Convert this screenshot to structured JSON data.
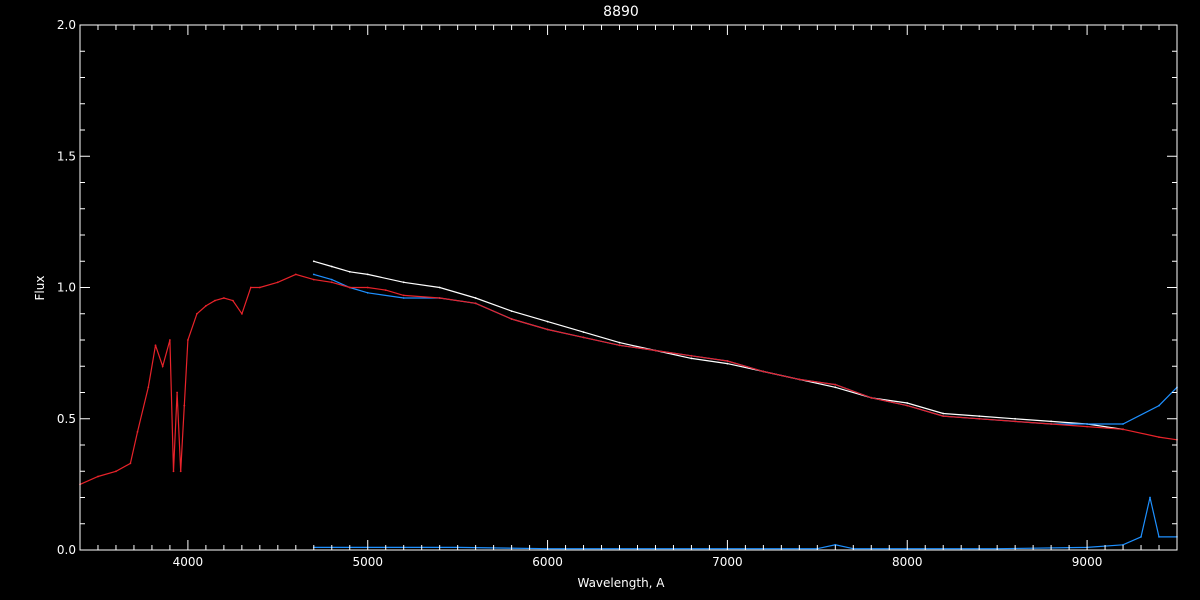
{
  "chart_data": {
    "type": "line",
    "title": "8890",
    "xlabel": "Wavelength, A",
    "ylabel": "Flux",
    "xlim": [
      3400,
      9500
    ],
    "ylim": [
      0.0,
      2.0
    ],
    "xticks": [
      4000,
      5000,
      6000,
      7000,
      8000,
      9000
    ],
    "xtick_labels": [
      "4000",
      "5000",
      "6000",
      "7000",
      "8000",
      "9000"
    ],
    "yticks": [
      0.0,
      0.5,
      1.0,
      1.5,
      2.0
    ],
    "ytick_labels": [
      "0.0",
      "0.5",
      "1.0",
      "1.5",
      "2.0"
    ],
    "grid": false,
    "background": "#000000",
    "series": [
      {
        "color": "#ffffff",
        "x": [
          4700,
          4800,
          4900,
          5000,
          5200,
          5400,
          5600,
          5800,
          6000,
          6200,
          6400,
          6600,
          6800,
          7000,
          7200,
          7400,
          7600,
          7800,
          8000,
          8200,
          8400,
          8600,
          8800,
          9000,
          9200
        ],
        "values": [
          1.1,
          1.08,
          1.06,
          1.05,
          1.02,
          1.0,
          0.96,
          0.91,
          0.87,
          0.83,
          0.79,
          0.76,
          0.73,
          0.71,
          0.68,
          0.65,
          0.62,
          0.58,
          0.56,
          0.52,
          0.51,
          0.5,
          0.49,
          0.48,
          0.46
        ]
      },
      {
        "color": "#1e90ff",
        "x": [
          4700,
          4800,
          4900,
          5000,
          5200,
          5400,
          5600,
          5800,
          6000,
          6200,
          6400,
          6600,
          6800,
          7000,
          7200,
          7400,
          7600,
          7800,
          8000,
          8200,
          8400,
          8600,
          8800,
          9000,
          9200,
          9400,
          9500
        ],
        "values": [
          1.05,
          1.03,
          1.0,
          0.98,
          0.96,
          0.96,
          0.94,
          0.88,
          0.84,
          0.81,
          0.78,
          0.76,
          0.74,
          0.72,
          0.68,
          0.65,
          0.63,
          0.58,
          0.55,
          0.51,
          0.5,
          0.49,
          0.48,
          0.48,
          0.48,
          0.55,
          0.62
        ]
      },
      {
        "color": "#1e90ff",
        "x": [
          4700,
          5000,
          5500,
          6000,
          6500,
          7000,
          7500,
          7600,
          7700,
          8000,
          8500,
          9000,
          9200,
          9300,
          9350,
          9400,
          9500
        ],
        "values": [
          0.01,
          0.01,
          0.01,
          0.005,
          0.005,
          0.005,
          0.005,
          0.02,
          0.005,
          0.005,
          0.005,
          0.01,
          0.02,
          0.05,
          0.2,
          0.05,
          0.05
        ]
      },
      {
        "color": "#e8232a",
        "x": [
          3400,
          3500,
          3600,
          3680,
          3720,
          3780,
          3820,
          3860,
          3900,
          3920,
          3940,
          3960,
          3980,
          4000,
          4050,
          4100,
          4150,
          4200,
          4250,
          4300,
          4350,
          4400,
          4500,
          4600,
          4700,
          4800,
          4900,
          5000,
          5100,
          5200,
          5400,
          5600,
          5800,
          6000,
          6200,
          6400,
          6600,
          6800,
          7000,
          7200,
          7400,
          7600,
          7800,
          8000,
          8200,
          8400,
          8600,
          8800,
          9000,
          9200,
          9400,
          9500
        ],
        "values": [
          0.25,
          0.28,
          0.3,
          0.33,
          0.45,
          0.62,
          0.78,
          0.7,
          0.8,
          0.3,
          0.6,
          0.3,
          0.55,
          0.8,
          0.9,
          0.93,
          0.95,
          0.96,
          0.95,
          0.9,
          1.0,
          1.0,
          1.02,
          1.05,
          1.03,
          1.02,
          1.0,
          1.0,
          0.99,
          0.97,
          0.96,
          0.94,
          0.88,
          0.84,
          0.81,
          0.78,
          0.76,
          0.74,
          0.72,
          0.68,
          0.65,
          0.63,
          0.58,
          0.55,
          0.51,
          0.5,
          0.49,
          0.48,
          0.47,
          0.46,
          0.43,
          0.42
        ]
      }
    ]
  }
}
